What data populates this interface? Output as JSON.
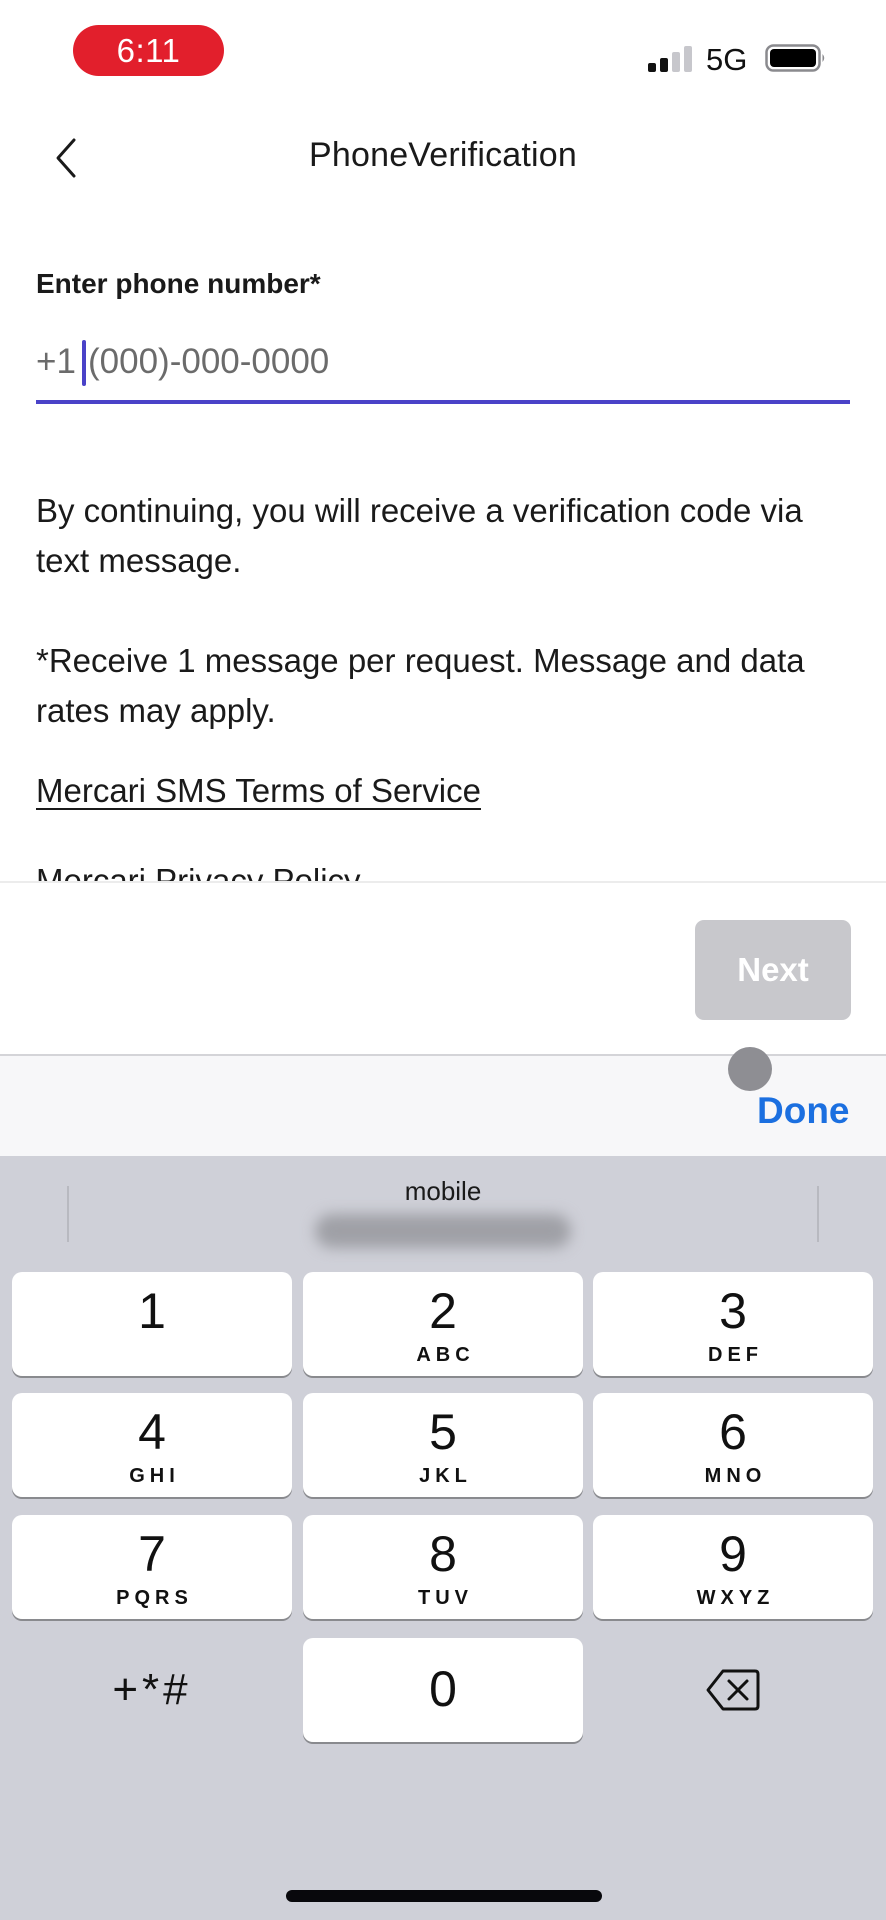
{
  "status_bar": {
    "time": "6:11",
    "network": "5G",
    "signal_bars_filled": 2,
    "signal_bars_total": 4,
    "battery_level": 1.0,
    "time_pill_color": "#e21f2c"
  },
  "nav": {
    "title": "PhoneVerification",
    "back_icon": "chevron-left-icon"
  },
  "form": {
    "label": "Enter phone number*",
    "country_prefix": "+1",
    "value": "",
    "placeholder": "(000)-000-0000",
    "accent_color": "#4a42c8"
  },
  "body": {
    "paragraph_1": "By continuing, you will receive a verification code via text message.",
    "paragraph_2": "*Receive 1 message per request. Message and data rates may apply.",
    "sms_terms_link": "Mercari SMS Terms of Service",
    "privacy_link": "Mercari Privacy Policy"
  },
  "footer": {
    "next_label": "Next",
    "next_enabled": false
  },
  "keyboard_toolbar": {
    "done_label": "Done",
    "done_color": "#1b6fe0"
  },
  "keyboard": {
    "suggestion_label": "mobile",
    "keys": [
      {
        "digit": "1",
        "letters": ""
      },
      {
        "digit": "2",
        "letters": "ABC"
      },
      {
        "digit": "3",
        "letters": "DEF"
      },
      {
        "digit": "4",
        "letters": "GHI"
      },
      {
        "digit": "5",
        "letters": "JKL"
      },
      {
        "digit": "6",
        "letters": "MNO"
      },
      {
        "digit": "7",
        "letters": "PQRS"
      },
      {
        "digit": "8",
        "letters": "TUV"
      },
      {
        "digit": "9",
        "letters": "WXYZ"
      },
      {
        "digit": "0",
        "letters": ""
      }
    ],
    "symbols_label": "+*#",
    "delete_icon": "backspace-icon"
  }
}
